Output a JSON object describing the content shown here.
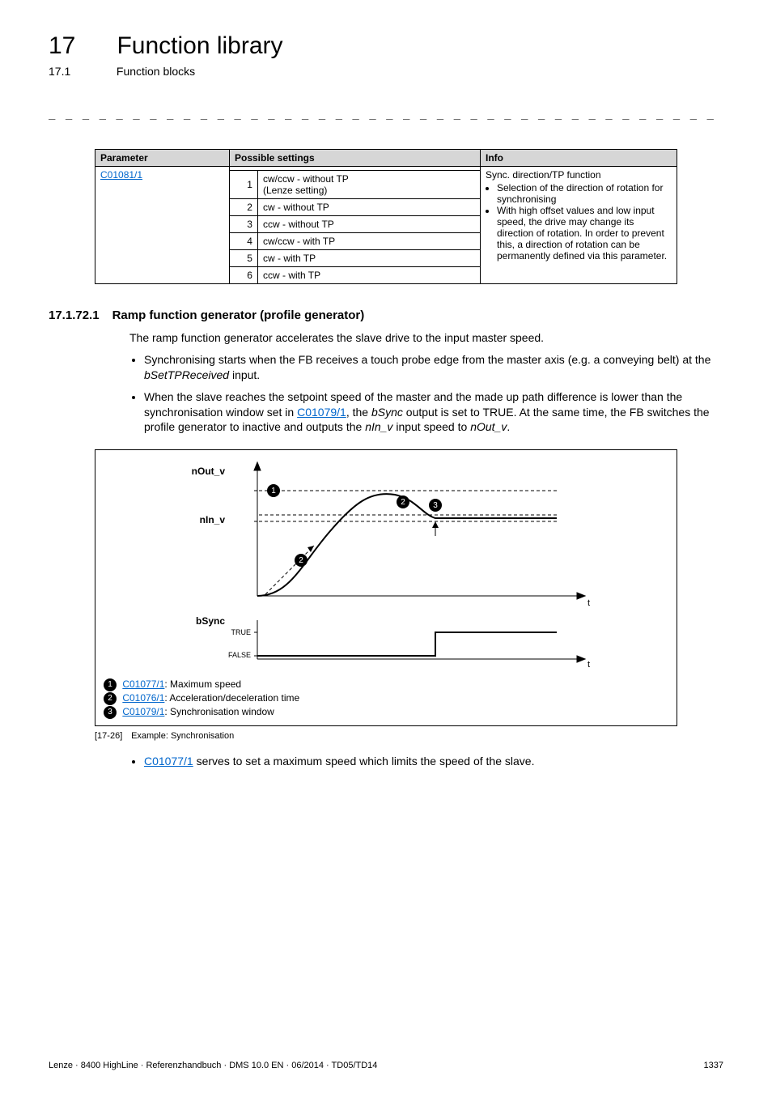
{
  "header": {
    "chapnum": "17",
    "chaptitle": "Function library",
    "subnum": "17.1",
    "subtitle": "Function blocks"
  },
  "param_table": {
    "headers": {
      "parameter": "Parameter",
      "possible": "Possible settings",
      "info": "Info"
    },
    "param_link": "C01081/1",
    "options": [
      {
        "n": "1",
        "text": "cw/ccw - without TP\n(Lenze setting)"
      },
      {
        "n": "2",
        "text": "cw - without TP"
      },
      {
        "n": "3",
        "text": "ccw - without TP"
      },
      {
        "n": "4",
        "text": "cw/ccw - with TP"
      },
      {
        "n": "5",
        "text": "cw - with TP"
      },
      {
        "n": "6",
        "text": "ccw - with TP"
      }
    ],
    "info_title": "Sync. direction/TP function",
    "info_bullets": [
      "Selection of the direction of rotation for synchronising",
      "With high offset values and low input speed, the drive may change its direction of rotation. In order to prevent this, a direction of rotation can be permanently defined via this parameter."
    ]
  },
  "section": {
    "num": "17.1.72.1",
    "title": "Ramp function generator (profile generator)",
    "intro": "The ramp function generator accelerates the slave drive to the input master speed.",
    "bullets_html": [
      "Synchronising starts when the FB receives a touch probe edge from the master axis (e.g. a conveying belt) at the <span class='ital'>bSetTPReceived</span> input.",
      "When the slave reaches the setpoint speed of the master and the made up path difference is lower than the synchronisation window set in <a href='#' class='link'>C01079/1</a>, the <span class='ital'>bSync</span> output is set to TRUE. At the same time, the FB switches the profile generator to inactive and outputs the <span class='ital'>nIn_v</span> input speed to <span class='ital'>nOut_v</span>."
    ]
  },
  "chart_data": {
    "type": "line",
    "title": "",
    "x_label": "t",
    "top_plot": {
      "y_labels": [
        "nOut_v",
        "nIn_v"
      ],
      "series": [
        {
          "name": "ramp",
          "description": "accelerates from 0, overshoots past nIn_v up to max (marker 1), settles back to nIn_v"
        }
      ],
      "markers": {
        "1": "maximum speed level (dashed)",
        "2": "acceleration/deceleration slope",
        "3": "synchronisation window band around nIn_v (dashed)"
      }
    },
    "bottom_plot": {
      "name": "bSync",
      "y_ticks": [
        "TRUE",
        "FALSE"
      ],
      "description": "step from FALSE to TRUE when sync achieved"
    }
  },
  "chart_legend": [
    {
      "n": "1",
      "link": "C01077/1",
      "text": ": Maximum speed"
    },
    {
      "n": "2",
      "link": "C01076/1",
      "text": ": Acceleration/deceleration time"
    },
    {
      "n": "3",
      "link": "C01079/1",
      "text": ": Synchronisation window"
    }
  ],
  "caption": {
    "fig": "[17-26]",
    "text": "Example: Synchronisation"
  },
  "after_bullet_html": "<a href='#' class='link'>C01077/1</a> serves to set a maximum speed which limits the speed of the slave.",
  "footer": {
    "left": "Lenze · 8400 HighLine · Referenzhandbuch · DMS 10.0 EN · 06/2014 · TD05/TD14",
    "right": "1337"
  }
}
